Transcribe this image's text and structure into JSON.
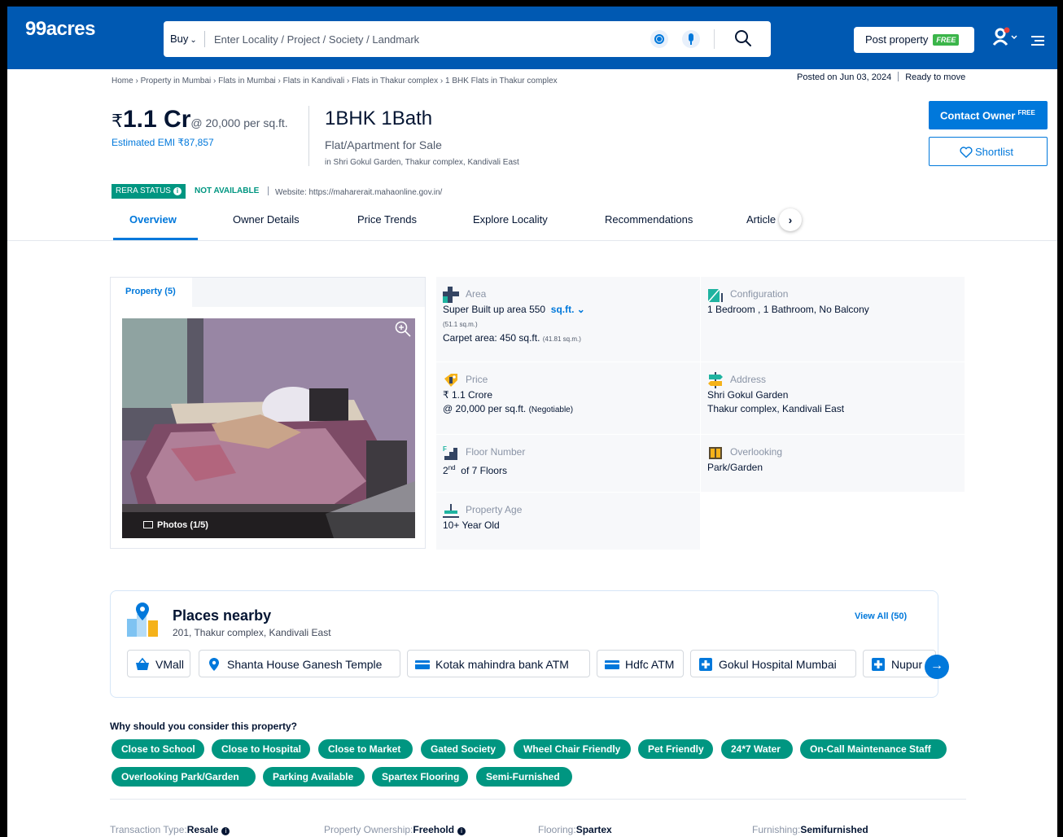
{
  "header": {
    "logo": "99acres",
    "search_mode": "Buy",
    "search_placeholder": "Enter Locality / Project / Society / Landmark",
    "post_property_label": "Post property",
    "free_tag": "FREE"
  },
  "breadcrumb": [
    "Home",
    "Property in Mumbai",
    "Flats in Mumbai",
    "Flats in Kandivali",
    "Flats in Thakur complex",
    "1 BHK Flats in Thakur complex"
  ],
  "posted": {
    "date": "Posted on Jun 03, 2024",
    "status": "Ready to move"
  },
  "listing": {
    "currency": "₹",
    "price": "1.1 Cr",
    "price_per_sqft": "@ 20,000 per sq.ft.",
    "emi": "Estimated EMI ₹87,857",
    "bhk": "1BHK 1Bath",
    "type": "Flat/Apartment for Sale",
    "address": "in Shri Gokul Garden, Thakur complex, Kandivali East"
  },
  "actions": {
    "contact": "Contact Owner",
    "contact_free": "FREE",
    "shortlist": "Shortlist"
  },
  "rera": {
    "label": "RERA STATUS",
    "status": "NOT AVAILABLE",
    "website": "Website: https://maharerait.mahaonline.gov.in/"
  },
  "tabs": [
    "Overview",
    "Owner Details",
    "Price Trends",
    "Explore Locality",
    "Recommendations",
    "Article"
  ],
  "gallery": {
    "tab": "Property (5)",
    "photos_label": "Photos (1/5)"
  },
  "details": {
    "area": {
      "label": "Area",
      "line1": "Super Built up area 550",
      "unit": "sq.ft.",
      "sqm": "(51.1 sq.m.)",
      "carpet": "Carpet area: 450 sq.ft.",
      "carpet_sqm": "(41.81 sq.m.)"
    },
    "configuration": {
      "label": "Configuration",
      "value": "1 Bedroom , 1 Bathroom, No Balcony"
    },
    "price": {
      "label": "Price",
      "value": "₹ 1.1 Crore",
      "per_sqft": "@ 20,000 per sq.ft.",
      "negotiable": "(Negotiable)"
    },
    "address": {
      "label": "Address",
      "line1": "Shri Gokul Garden",
      "line2": "Thakur complex, Kandivali East"
    },
    "floor": {
      "label": "Floor Number",
      "value": "2",
      "suffix": "nd",
      "rest": "of 7 Floors"
    },
    "overlooking": {
      "label": "Overlooking",
      "value": "Park/Garden"
    },
    "age": {
      "label": "Property Age",
      "value": "10+ Year Old"
    }
  },
  "places": {
    "title": "Places nearby",
    "address": "201, Thakur complex, Kandivali East",
    "view_all": "View All (50)",
    "items": [
      "VMall",
      "Shanta House Ganesh Temple",
      "Kotak mahindra bank ATM",
      "Hdfc ATM",
      "Gokul Hospital Mumbai",
      "Nupur"
    ]
  },
  "why": {
    "title": "Why should you consider this property?",
    "tags": [
      "Close to School",
      "Close to Hospital",
      "Close to Market",
      "Gated Society",
      "Wheel Chair Friendly",
      "Pet Friendly",
      "24*7 Water",
      "On-Call Maintenance Staff",
      "Overlooking Park/Garden",
      "Parking Available",
      "Spartex Flooring",
      "Semi-Furnished"
    ]
  },
  "attributes": [
    {
      "key": "Transaction Type",
      "value": "Resale",
      "info": true
    },
    {
      "key": "Property Ownership",
      "value": "Freehold",
      "info": true
    },
    {
      "key": "Flooring",
      "value": "Spartex",
      "info": false
    },
    {
      "key": "Furnishing",
      "value": "Semifurnished",
      "info": false
    }
  ],
  "colors": {
    "brand": "#0059b2",
    "accent": "#0078db",
    "green": "#009681"
  }
}
